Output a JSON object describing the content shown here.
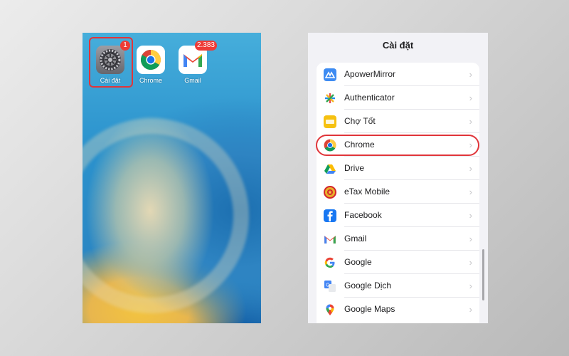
{
  "home_screen": {
    "apps": [
      {
        "label": "Cài đặt",
        "badge": "1",
        "icon": "settings-gear-icon"
      },
      {
        "label": "Chrome",
        "badge": "",
        "icon": "chrome-icon"
      },
      {
        "label": "Gmail",
        "badge": "2.383",
        "icon": "gmail-icon"
      }
    ],
    "highlighted_app": "Cài đặt"
  },
  "settings_screen": {
    "title": "Cài đặt",
    "highlighted_item": "Chrome",
    "items": [
      {
        "label": "ApowerMirror",
        "icon": "apowermirror-icon",
        "color": "#3d8bf2"
      },
      {
        "label": "Authenticator",
        "icon": "authenticator-icon",
        "color": "#ffffff"
      },
      {
        "label": "Chợ Tốt",
        "icon": "chotot-icon",
        "color": "#f6c111"
      },
      {
        "label": "Chrome",
        "icon": "chrome-icon",
        "color": "#ffffff"
      },
      {
        "label": "Drive",
        "icon": "drive-icon",
        "color": "#ffffff"
      },
      {
        "label": "eTax Mobile",
        "icon": "etax-icon",
        "color": "#d4262b"
      },
      {
        "label": "Facebook",
        "icon": "facebook-icon",
        "color": "#1877f2"
      },
      {
        "label": "Gmail",
        "icon": "gmail-icon",
        "color": "#ffffff"
      },
      {
        "label": "Google",
        "icon": "google-icon",
        "color": "#ffffff"
      },
      {
        "label": "Google Dịch",
        "icon": "google-translate-icon",
        "color": "#4285f4"
      },
      {
        "label": "Google Maps",
        "icon": "google-maps-icon",
        "color": "#ffffff"
      }
    ]
  },
  "colors": {
    "highlight": "#e0353a",
    "badge": "#ee3b36"
  }
}
